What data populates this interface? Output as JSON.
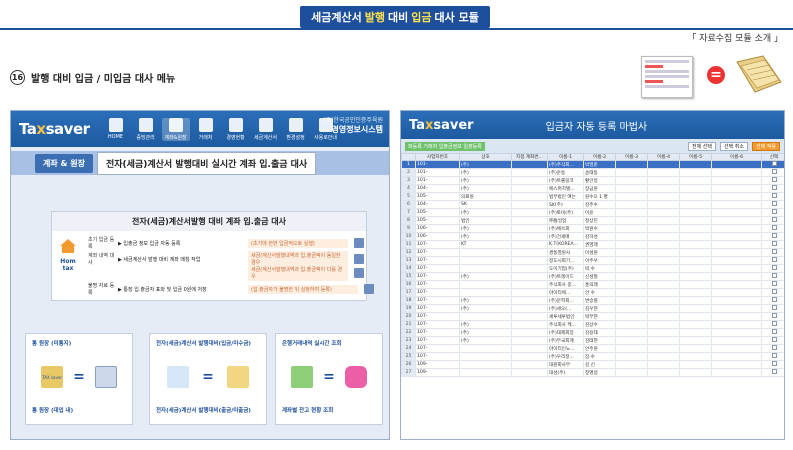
{
  "banner": {
    "pre": "세금계산서",
    "hl1": "발행",
    "mid": "대비",
    "hl2": "입금",
    "post": "대사 모듈"
  },
  "right_note": "「 자료수집 모듈 소개 」",
  "section": {
    "number": "16",
    "title": "발행 대비 입금 / 미입금 대사 메뉴"
  },
  "left": {
    "logo_a": "Ta",
    "logo_x": "x",
    "logo_b": "saver",
    "nav": [
      "HOME",
      "증빙관리",
      "계좌&원장",
      "거래처",
      "경영현황",
      "세금계산서",
      "환경설정",
      "사용로안내"
    ],
    "company_1": "(주)한국공인인증주육원",
    "company_2": "경영정보시스템",
    "tab_button": "계좌 & 원장",
    "tab_title": "전자(세금)계산서 발행대비 실시간 계좌 입.출금 대사",
    "flow_title": "전자(세금)계산서발행 대비 계좌 입.출금 대사",
    "hometax": "Hom tax",
    "flow_rows": [
      {
        "label": "초기 입금 등록",
        "text": "▶ 입출금 정보 입금 자동 등록",
        "note": "(초기에 한번 입금적으로 실행)"
      },
      {
        "label": "계좌 내역 대사",
        "text": "▶ 세금계산서 발행 대비 계좌 매칭 작업",
        "note": "세금(계산서발행내역과 입.출금액이 동일한 경우"
      },
      {
        "label": "",
        "text": "",
        "note": "세금(계산서발행내역과 입.출금액이 다를 경우"
      },
      {
        "label": "불명 자료 등록",
        "text": "▶ 통장 입.출금자 표와 및 입금 0원에 저장",
        "note": "(입.출금자가 불명한 뒤 실정하여 등록)"
      }
    ],
    "cards": [
      {
        "top": "통 원장 (미통지)",
        "bottom": "통 원장 (대입 내)",
        "logo": "TAX saver"
      },
      {
        "top": "전자(세금)계산서 발행대비(입금/미수금)",
        "bottom": "전자(세금)계산서 발행대비(출금/미출금)"
      },
      {
        "top": "은행거래내역 실시간 조회",
        "bottom": "계좌별 잔고 현황 조회"
      }
    ]
  },
  "right": {
    "logo_a": "Ta",
    "logo_x": "x",
    "logo_b": "saver",
    "title": "입금자 자동 등록 마법사",
    "sub_left": "퍼등록 거래처 입출금정보 일괄등록",
    "buttons": [
      "전체 선택",
      "선택 취소",
      "선택 적용"
    ],
    "columns": [
      "",
      "사업자번호",
      "상호",
      "지점 계좌번...",
      "이름-1",
      "이름-2",
      "이름-3",
      "이름-4",
      "이름-5",
      "이름-6",
      "선택"
    ],
    "rows": [
      [
        "1",
        "101-",
        "(주)",
        "",
        "(주)주식회...",
        "박영준"
      ],
      [
        "2",
        "101-",
        "(주)",
        "",
        "(주)운동",
        "송태동"
      ],
      [
        "3",
        "101-",
        "(주)",
        "",
        "(주)트롤링코",
        "황인일"
      ],
      [
        "4",
        "104-",
        "(주)",
        "",
        "에스퍼치텔...",
        "장금원"
      ],
      [
        "5",
        "105-",
        "의료원",
        "",
        "법무법인 여는",
        "원수오 1 명"
      ],
      [
        "6",
        "104-",
        "SK",
        "",
        "SK(주)",
        "김주수"
      ],
      [
        "7",
        "105-",
        "(주)",
        "",
        "(주)토비(주)",
        "이윤",
        ""
      ],
      [
        "8",
        "105-",
        "법인",
        "",
        "㈜통일업",
        "정상진"
      ],
      [
        "9",
        "106-",
        "(주)",
        "",
        "(주)에쓰회",
        "박원수"
      ],
      [
        "10",
        "106-",
        "(주)",
        "",
        "(주)건세매",
        "김하성"
      ],
      [
        "11",
        "107-",
        "KT",
        "",
        "K.T(KOREA...",
        "권영래"
      ],
      [
        "12",
        "107-",
        "",
        "",
        "경동영원사",
        "이성원"
      ],
      [
        "13",
        "107-",
        "",
        "",
        "정도시회기...",
        "이주우"
      ],
      [
        "14",
        "107-",
        "",
        "",
        "도이기업(주)",
        "박 수"
      ],
      [
        "15",
        "107-",
        "(주)",
        "",
        "(주)트레이드",
        "신성철"
      ],
      [
        "16",
        "107-",
        "",
        "",
        "주식회사 중...",
        "홍의래"
      ],
      [
        "17",
        "107-",
        "",
        "",
        "아이티에...",
        "안 수"
      ],
      [
        "18",
        "107-",
        "(주)",
        "",
        "(주)문학회...",
        "변승렬"
      ],
      [
        "19",
        "107-",
        "(주)",
        "",
        "(주)세오(...",
        "김우현"
      ],
      [
        "20",
        "107-",
        "",
        "",
        "세루세루법인",
        "박무현"
      ],
      [
        "21",
        "107-",
        "(주)",
        "",
        "주식회사 케...",
        "김상수"
      ],
      [
        "22",
        "107-",
        "(주)",
        "",
        "(주)대제회장",
        "김용태"
      ],
      [
        "23",
        "107-",
        "(주)",
        "",
        "(주)부국회계",
        "김태현"
      ],
      [
        "24",
        "107-",
        "",
        "",
        "아이티인노...",
        "안주원"
      ],
      [
        "25",
        "107-",
        "",
        "",
        "(주)우리정...",
        "장 수"
      ],
      [
        "26",
        "109-",
        "",
        "",
        "대원회사무",
        "김 신"
      ],
      [
        "27",
        "109-",
        "",
        "",
        "대성(주)",
        "정명섭"
      ]
    ]
  },
  "colors": {
    "accent": "#1e4f9c",
    "highlight": "#ffe24a",
    "selected_row": "#3a6fc4"
  }
}
